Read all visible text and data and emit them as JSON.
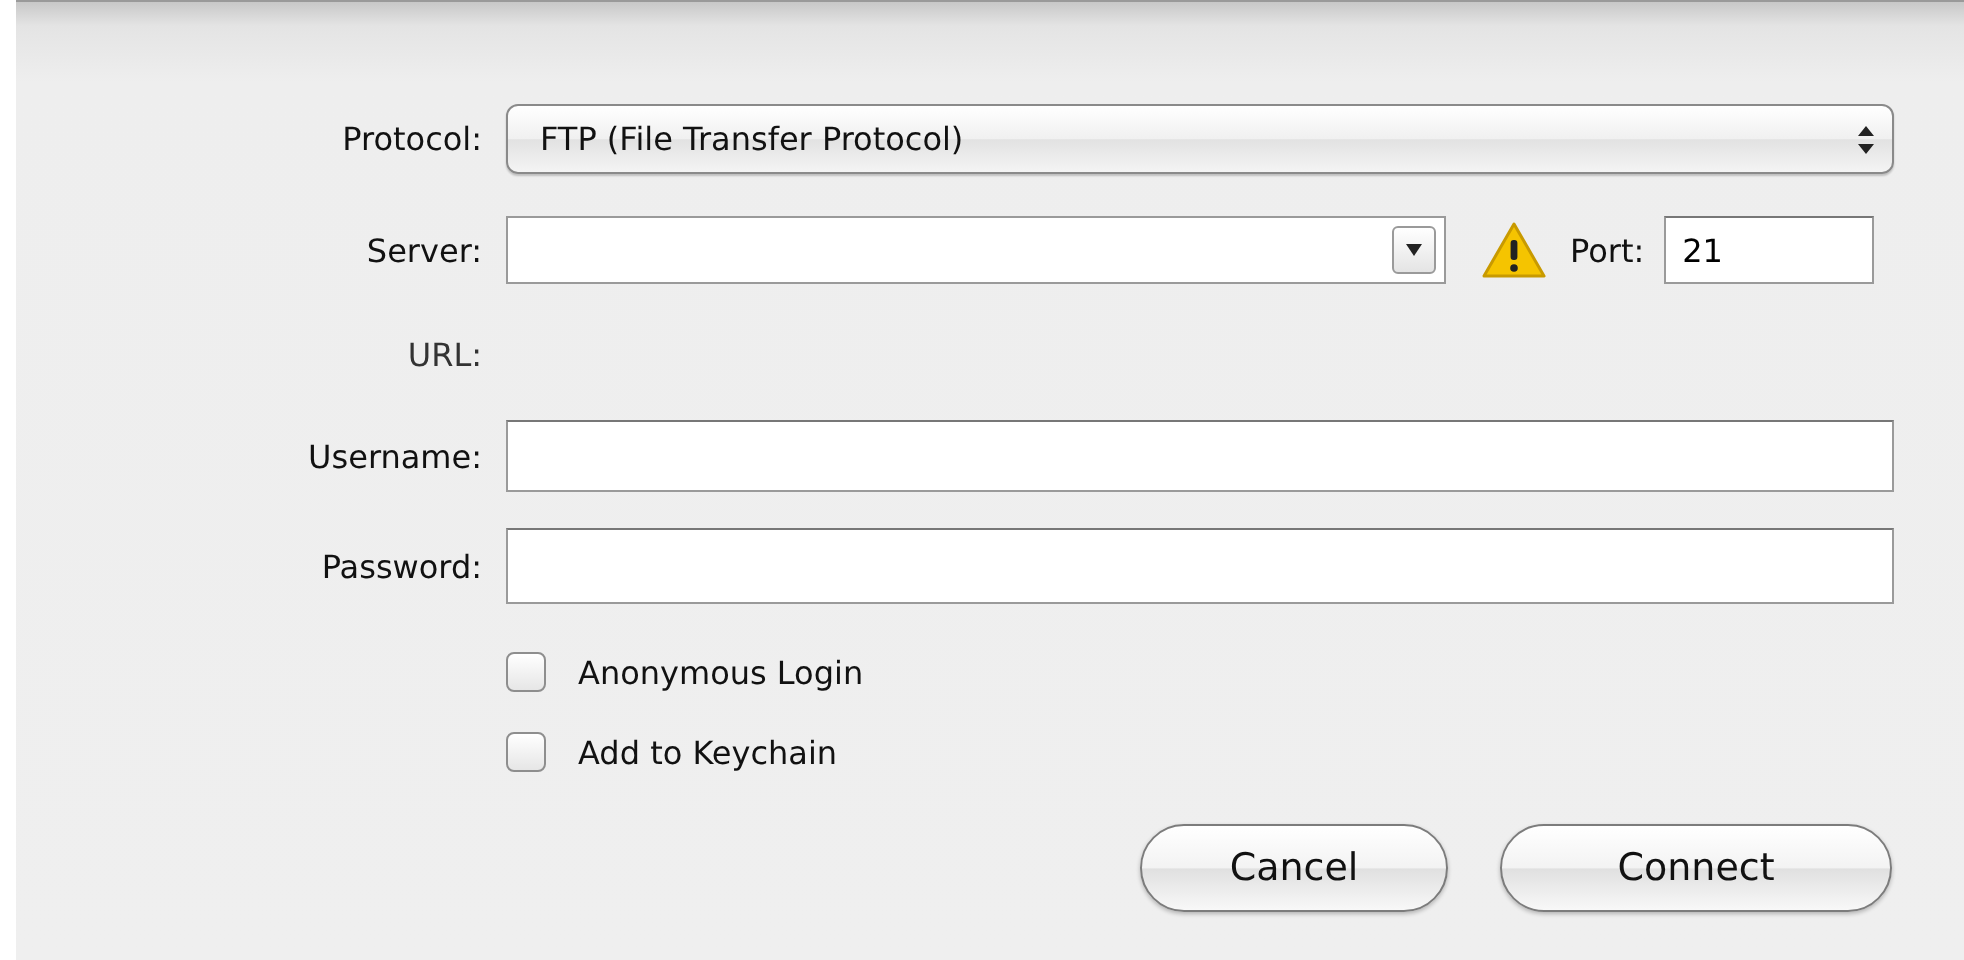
{
  "protocol": {
    "label": "Protocol:",
    "value": "FTP (File Transfer Protocol)"
  },
  "server": {
    "label": "Server:",
    "warning": true
  },
  "port": {
    "label": "Port:",
    "value": "21"
  },
  "url": {
    "label": "URL:"
  },
  "username": {
    "label": "Username:"
  },
  "password": {
    "label": "Password:"
  },
  "options": [
    {
      "label": "Anonymous Login",
      "checked": false
    },
    {
      "label": "Add to Keychain",
      "checked": false
    }
  ],
  "buttons": [
    {
      "label": "Cancel"
    },
    {
      "label": "Connect"
    }
  ]
}
